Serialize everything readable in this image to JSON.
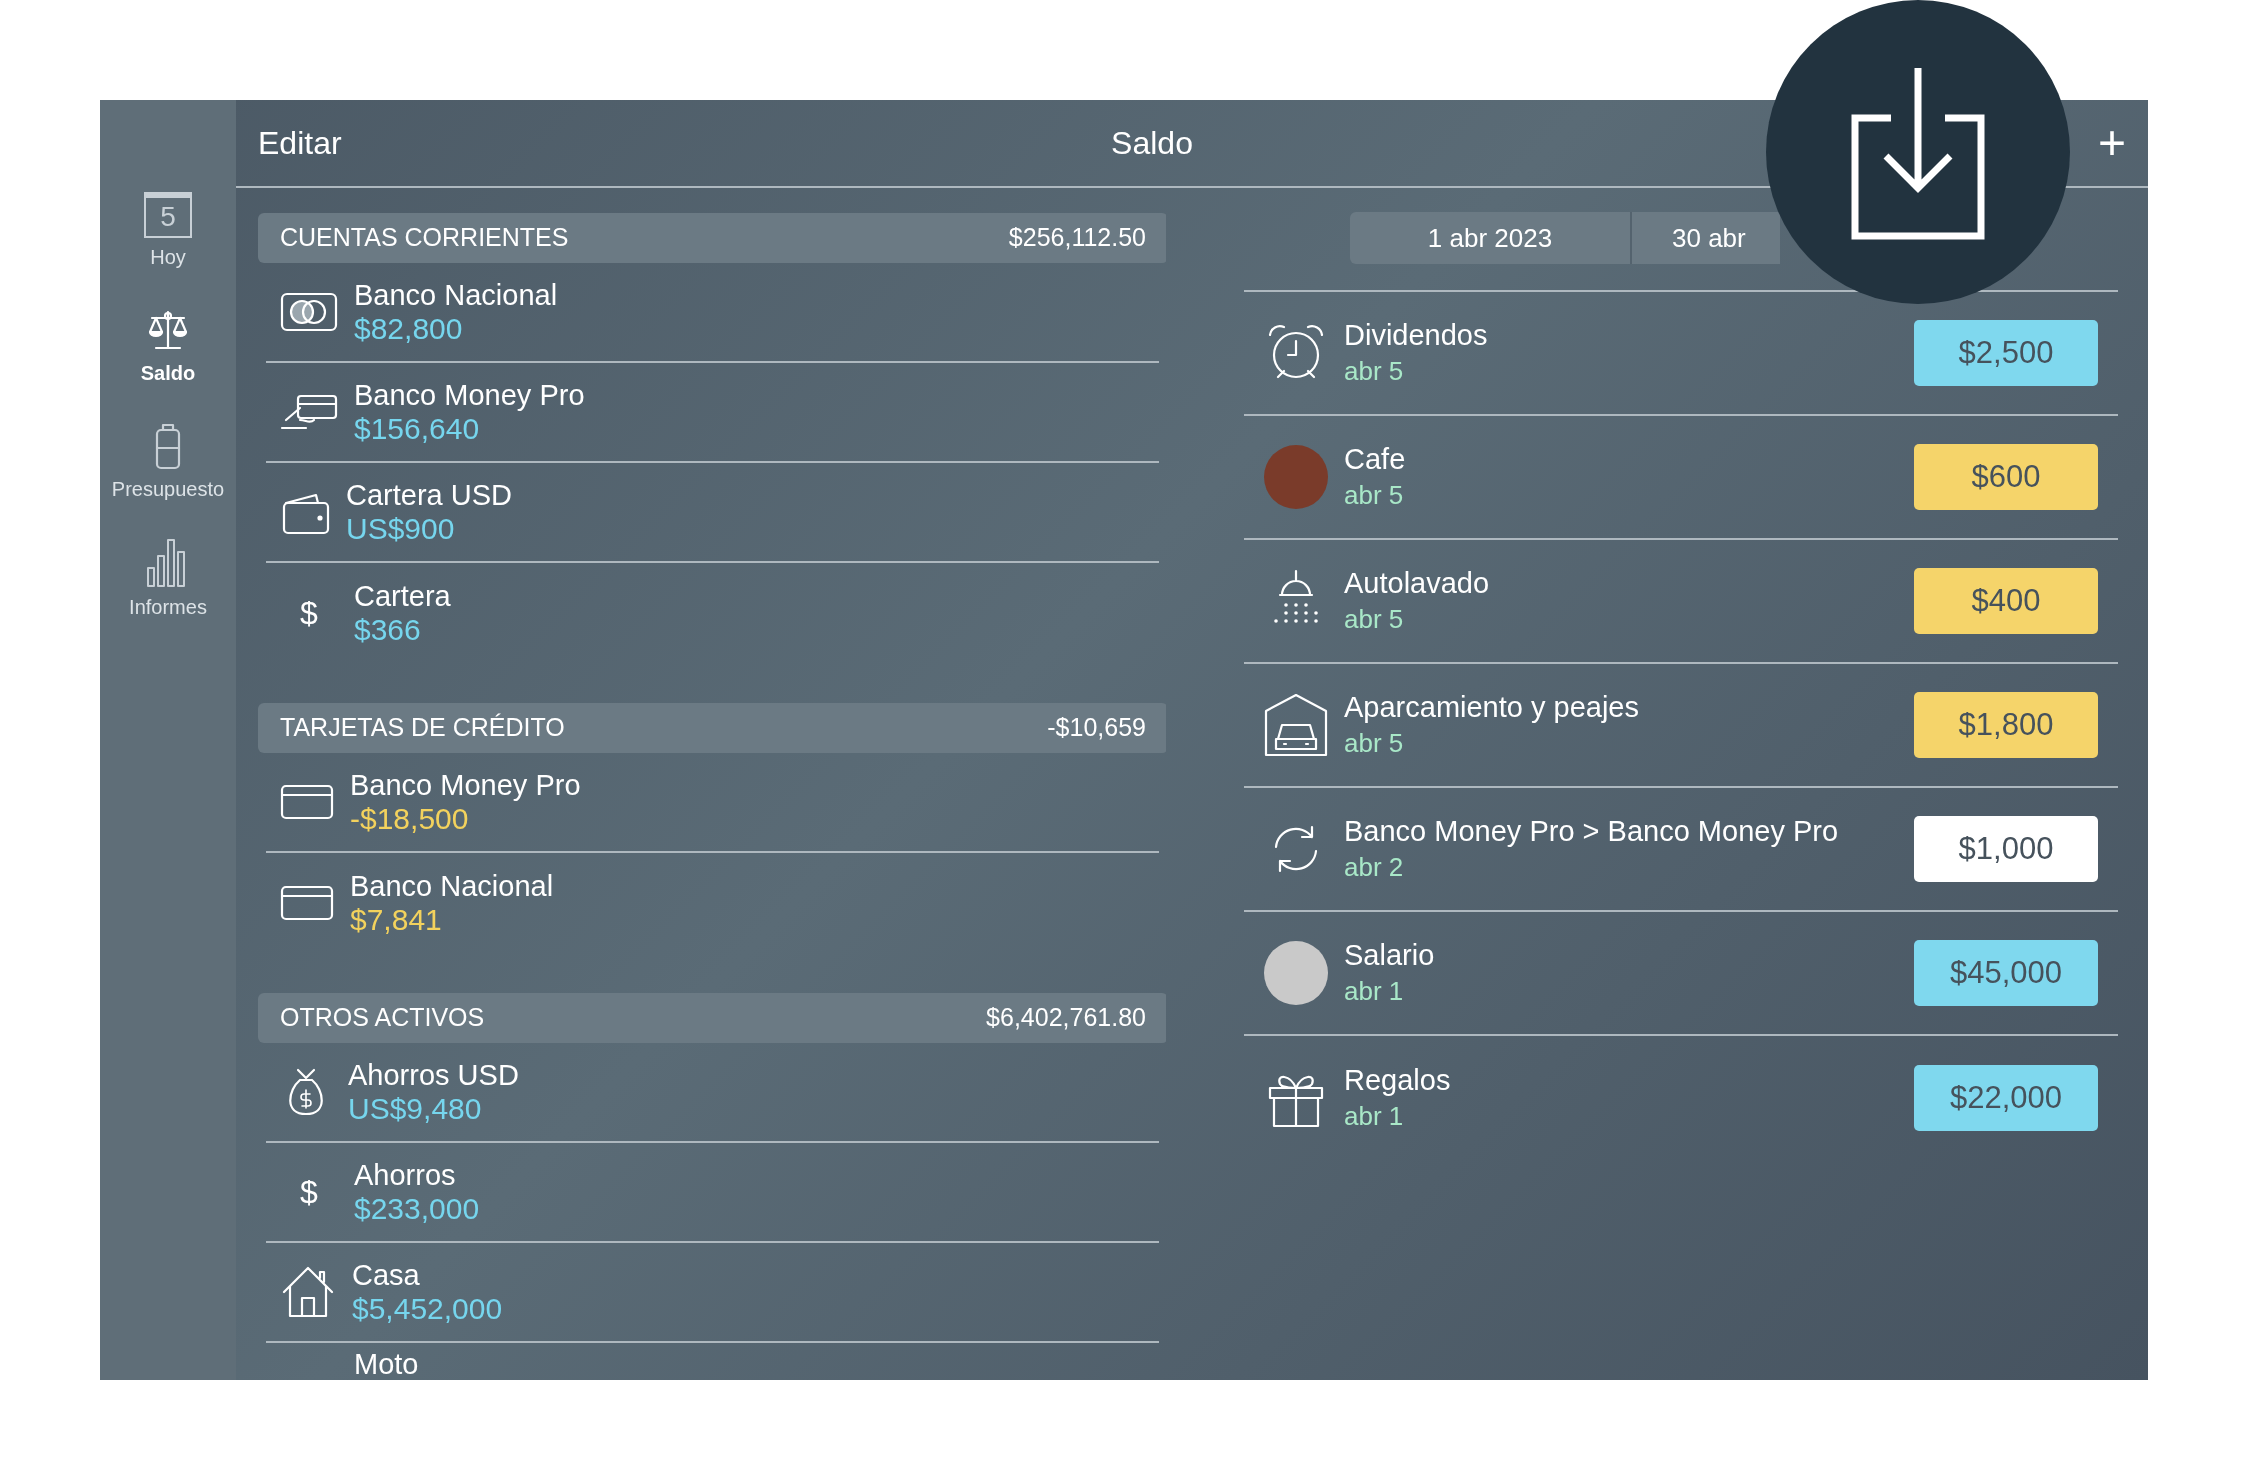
{
  "sidebar": {
    "items": [
      {
        "label": "Hoy",
        "badge": "5",
        "selected": false
      },
      {
        "label": "Saldo",
        "selected": true
      },
      {
        "label": "Presupuesto",
        "selected": false
      },
      {
        "label": "Informes",
        "selected": false
      }
    ]
  },
  "toolbar": {
    "edit": "Editar",
    "title": "Saldo",
    "add": "+"
  },
  "sections": [
    {
      "title": "CUENTAS CORRIENTES",
      "total": "$256,112.50",
      "kind": "asset",
      "accounts": [
        {
          "name": "Banco Nacional",
          "balance": "$82,800"
        },
        {
          "name": "Banco Money Pro",
          "balance": "$156,640"
        },
        {
          "name": "Cartera USD",
          "balance": "US$900"
        },
        {
          "name": "Cartera",
          "balance": "$366",
          "icon": "$"
        }
      ]
    },
    {
      "title": "TARJETAS DE CRÉDITO",
      "total": "-$10,659",
      "kind": "credit",
      "accounts": [
        {
          "name": "Banco Money Pro",
          "balance": "-$18,500"
        },
        {
          "name": "Banco Nacional",
          "balance": "$7,841"
        }
      ]
    },
    {
      "title": "OTROS ACTIVOS",
      "total": "$6,402,761.80",
      "kind": "asset",
      "accounts": [
        {
          "name": "Ahorros USD",
          "balance": "US$9,480"
        },
        {
          "name": "Ahorros",
          "balance": "$233,000",
          "icon": "$"
        },
        {
          "name": "Casa",
          "balance": "$5,452,000"
        },
        {
          "name": "Moto"
        }
      ]
    }
  ],
  "period": {
    "start": "1 abr 2023",
    "end": "30 abr"
  },
  "transactions": [
    {
      "name": "Dividendos",
      "date": "abr 5",
      "amount": "$2,500",
      "kind": "income"
    },
    {
      "name": "Cafe",
      "date": "abr 5",
      "amount": "$600",
      "kind": "expense"
    },
    {
      "name": "Autolavado",
      "date": "abr 5",
      "amount": "$400",
      "kind": "expense"
    },
    {
      "name": "Aparcamiento y peajes",
      "date": "abr 5",
      "amount": "$1,800",
      "kind": "expense"
    },
    {
      "name": "Banco Money Pro > Banco Money Pro",
      "date": "abr 2",
      "amount": "$1,000",
      "kind": "transfer"
    },
    {
      "name": "Salario",
      "date": "abr 1",
      "amount": "$45,000",
      "kind": "income"
    },
    {
      "name": "Regalos",
      "date": "abr 1",
      "amount": "$22,000",
      "kind": "income"
    }
  ]
}
